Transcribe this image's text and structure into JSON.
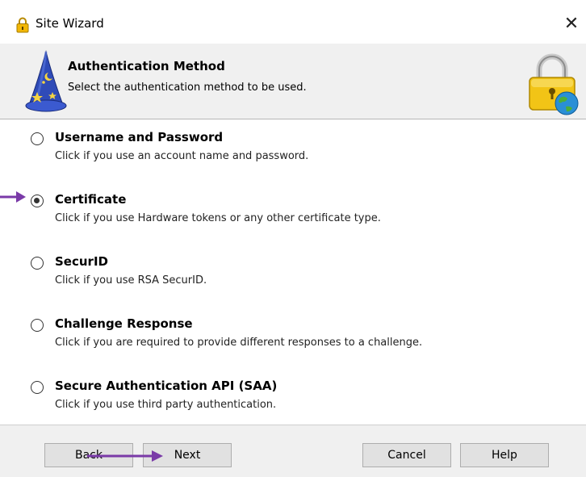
{
  "window": {
    "title": "Site Wizard",
    "close_glyph": "✕"
  },
  "header": {
    "title": "Authentication Method",
    "subtitle": "Select the authentication method to be used."
  },
  "options": [
    {
      "label": "Username and Password",
      "description": "Click if you use an account name and password.",
      "selected": false
    },
    {
      "label": "Certificate",
      "description": "Click if you use Hardware tokens or any other certificate type.",
      "selected": true
    },
    {
      "label": "SecurID",
      "description": "Click if you use RSA SecurID.",
      "selected": false
    },
    {
      "label": "Challenge Response",
      "description": "Click if you are required to provide different responses to a challenge.",
      "selected": false
    },
    {
      "label": "Secure Authentication API (SAA)",
      "description": "Click if you use third party authentication.",
      "selected": false
    }
  ],
  "footer": {
    "back_label": "Back",
    "next_label": "Next",
    "cancel_label": "Cancel",
    "help_label": "Help"
  },
  "colors": {
    "annotation_arrow": "#7a3aa8",
    "header_bg": "#f0f0f0",
    "button_bg": "#e1e1e1"
  },
  "icons": {
    "title": "lock-icon",
    "wizard": "wizard-hat-icon",
    "header_right": "lock-globe-icon"
  }
}
